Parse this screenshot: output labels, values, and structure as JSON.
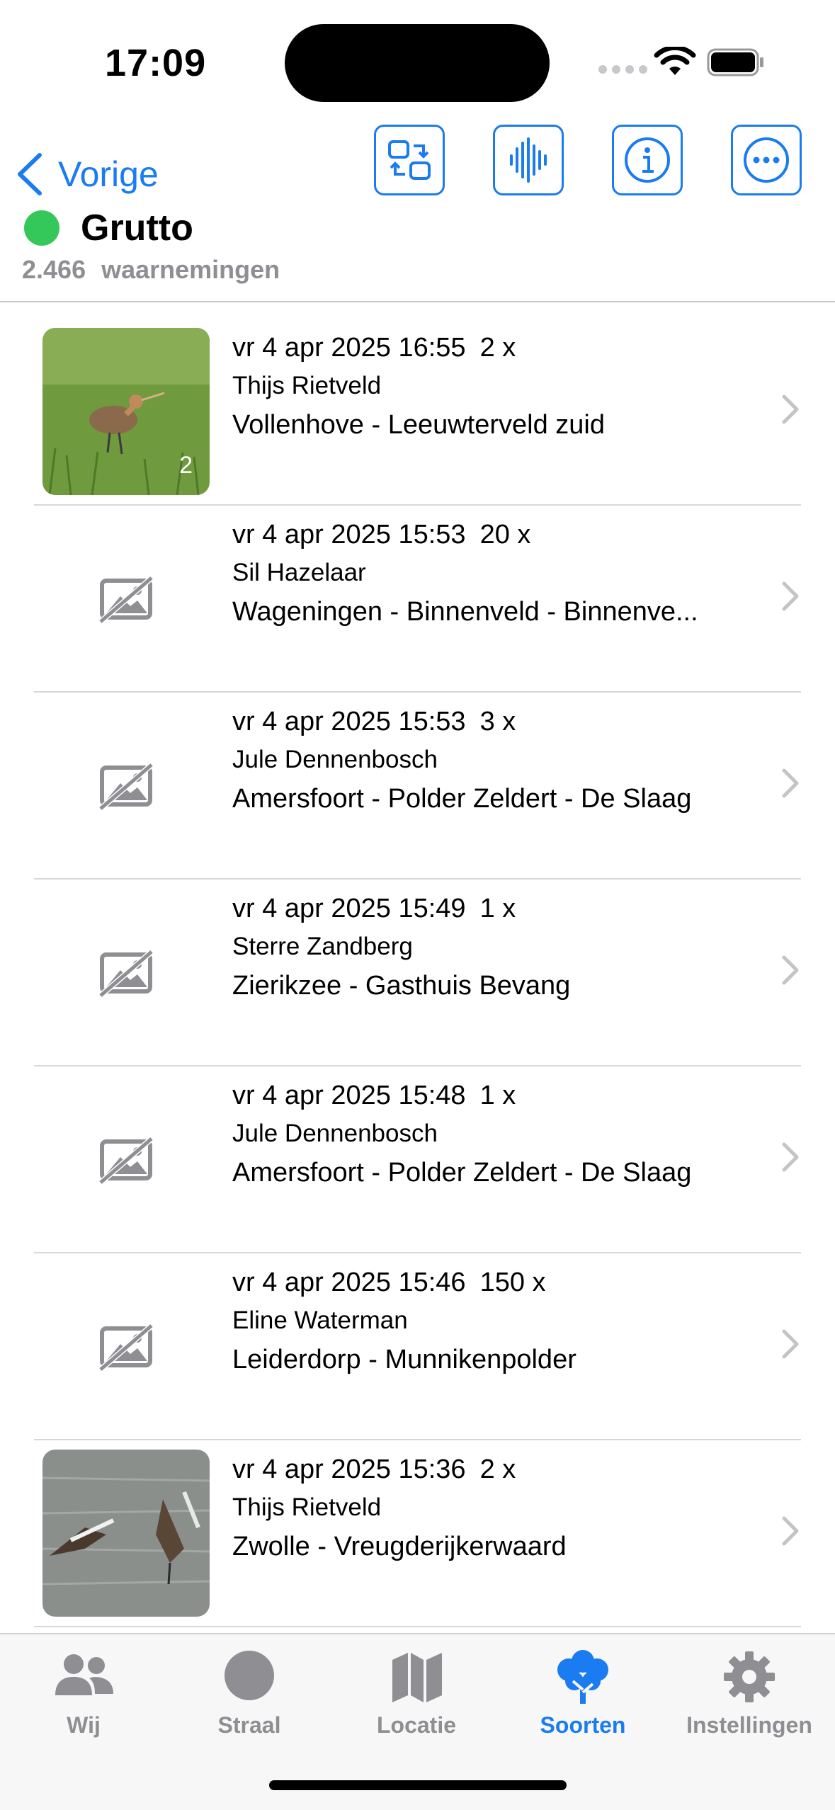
{
  "status_bar": {
    "time": "17:09"
  },
  "nav": {
    "back_label": "Vorige",
    "species_name": "Grutto",
    "observation_count": "2.466",
    "observation_label": "waarnemingen",
    "status_color": "#34c759",
    "accent_color": "#1a7cf0",
    "tools": [
      "swap-icon",
      "waveform-icon",
      "info-icon",
      "more-icon"
    ]
  },
  "observations": [
    {
      "datetime": "vr 4 apr 2025 16:55",
      "quantity": "2 x",
      "observer": "Thijs Rietveld",
      "location": "Vollenhove - Leeuwterveld zuid",
      "photo": "grutto-grass",
      "photo_count": "2"
    },
    {
      "datetime": "vr 4 apr 2025 15:53",
      "quantity": "20 x",
      "observer": "Sil Hazelaar",
      "location": "Wageningen - Binnenveld - Binnenve...",
      "photo": "none"
    },
    {
      "datetime": "vr 4 apr 2025 15:53",
      "quantity": "3 x",
      "observer": "Jule Dennenbosch",
      "location": "Amersfoort - Polder Zeldert - De Slaag",
      "photo": "none"
    },
    {
      "datetime": "vr 4 apr 2025 15:49",
      "quantity": "1 x",
      "observer": "Sterre Zandberg",
      "location": "Zierikzee - Gasthuis Bevang",
      "photo": "none"
    },
    {
      "datetime": "vr 4 apr 2025 15:48",
      "quantity": "1 x",
      "observer": "Jule Dennenbosch",
      "location": "Amersfoort - Polder Zeldert - De Slaag",
      "photo": "none"
    },
    {
      "datetime": "vr 4 apr 2025 15:46",
      "quantity": "150 x",
      "observer": "Eline Waterman",
      "location": "Leiderdorp - Munnikenpolder",
      "photo": "none"
    },
    {
      "datetime": "vr 4 apr 2025 15:36",
      "quantity": "2 x",
      "observer": "Thijs Rietveld",
      "location": "Zwolle - Vreugderijkerwaard",
      "photo": "grutto-water"
    }
  ],
  "tabs": [
    {
      "label": "Wij",
      "icon": "people-icon"
    },
    {
      "label": "Straal",
      "icon": "circle-icon"
    },
    {
      "label": "Locatie",
      "icon": "map-icon"
    },
    {
      "label": "Soorten",
      "icon": "tree-icon",
      "active": true
    },
    {
      "label": "Instellingen",
      "icon": "gear-icon"
    }
  ]
}
